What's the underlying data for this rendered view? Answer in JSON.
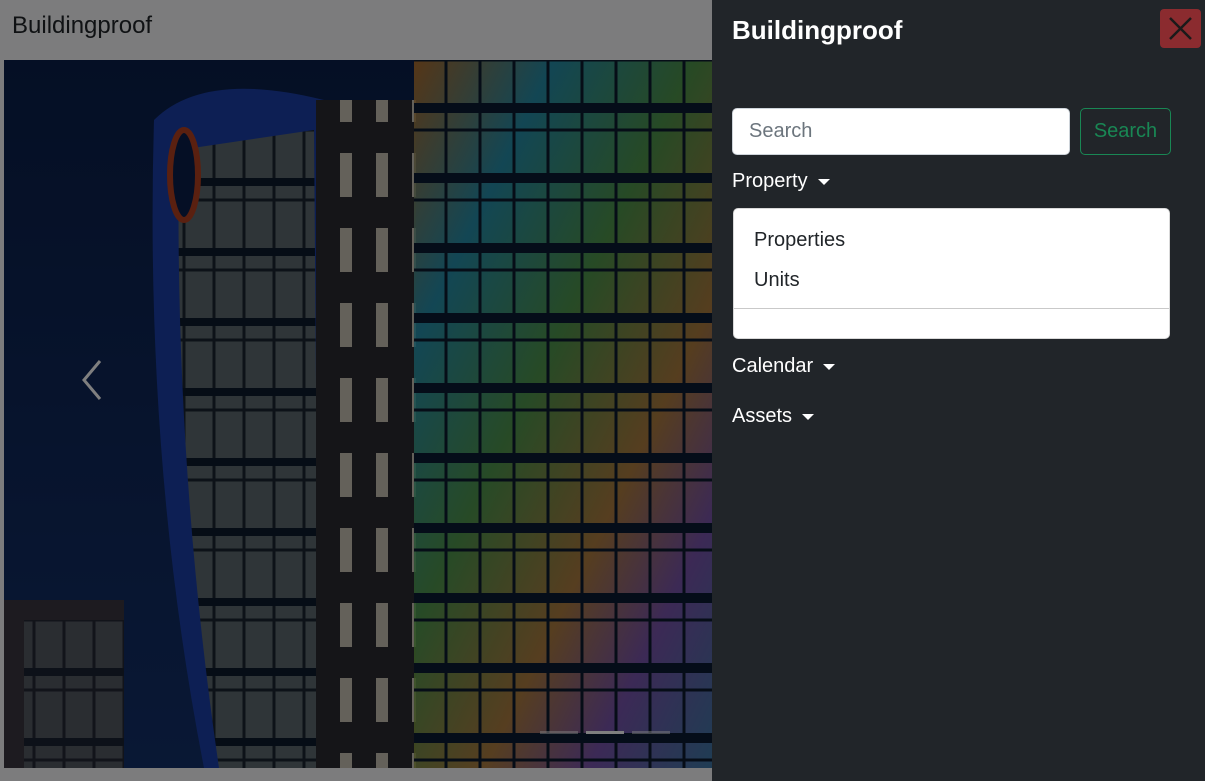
{
  "navbar": {
    "brand": "Buildingproof"
  },
  "carousel": {
    "prev_icon": "chevron-left-icon",
    "indicators": [
      {
        "active": false
      },
      {
        "active": true
      },
      {
        "active": false
      }
    ]
  },
  "offcanvas": {
    "title": "Buildingproof",
    "close_icon": "close-icon",
    "search": {
      "placeholder": "Search",
      "value": "",
      "button_label": "Search"
    },
    "property": {
      "label": "Property",
      "items": [
        "Properties",
        "Units"
      ]
    },
    "calendar": {
      "label": "Calendar"
    },
    "assets": {
      "label": "Assets"
    }
  },
  "colors": {
    "offcanvas_bg": "#212529",
    "close_button": "#8b2b2f",
    "search_button": "#198754"
  }
}
